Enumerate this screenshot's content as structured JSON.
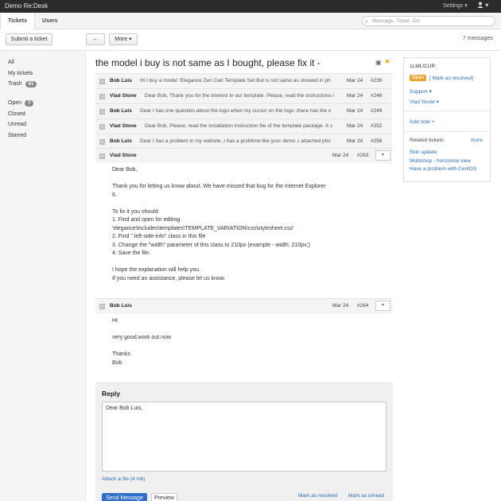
{
  "topbar": {
    "brand": "Demo Re:Desk",
    "settings_label": "Settings",
    "settings_caret": "▾",
    "user_icon": "user-icon",
    "user_caret": "▾"
  },
  "tabs": [
    {
      "label": "Tickets"
    },
    {
      "label": "Users"
    }
  ],
  "search": {
    "placeholder": "Message, Ticket, IDs"
  },
  "toolbar": {
    "submit_label": "Submit a ticket",
    "back_label": "←",
    "more_label": "More ▾",
    "message_count": "7 messages"
  },
  "sidebar": {
    "all": "All",
    "my_tickets": "My tickets",
    "trash": "Trash",
    "trash_count": "61",
    "open": "Open",
    "open_count": "7",
    "closed": "Closed",
    "unread": "Unread",
    "starred": "Starred"
  },
  "ticket": {
    "title": "the model i buy is not same as I bought, please fix it -"
  },
  "messages": [
    {
      "name": "Bob Luis",
      "preview": "Hi I buy a model :Elegance Zen Cart Template Set But is not same as showed in pho",
      "date": "Mar 24",
      "num": "#239"
    },
    {
      "name": "Vlad Stone",
      "preview": "Dear Bob, Thank you for the interest in our template. Please, read the instructions i",
      "date": "Mar 24",
      "num": "#246"
    },
    {
      "name": "Bob Luis",
      "preview": "Dear I has one question about the logo when my cursor on the logo ,there has the w",
      "date": "Mar 24",
      "num": "#249"
    },
    {
      "name": "Vlad Stone",
      "preview": "Dear Bob, Please, read the installation instruction file of the template package. It s",
      "date": "Mar 24",
      "num": "#252"
    },
    {
      "name": "Bob Luis",
      "preview": "Dear I has a problem in my website ,i has a problime like your demo ,i attached photo",
      "date": "Mar 24",
      "num": "#256"
    }
  ],
  "expanded1": {
    "name": "Vlad Stone",
    "date": "Mar 24",
    "num": "#263",
    "lines": [
      "Dear Bob,",
      "",
      "Thank you for letting us know about. We have missed that bug for the Internet Explorer",
      "6.",
      "",
      "To fix it you should:",
      "1. Find and open for editing",
      "'elegance\\includes\\templates\\TEMPLATE_VARIATION\\css\\stylesheet.css'",
      "2. Find \".left-side-info\" class in this file",
      "3. Change the \"width\" parameter of this class to 210px (example - width: 210px;)",
      "4. Save the file.",
      "",
      "I hope the explanation will help you.",
      "If you need an assistance, please let us know."
    ]
  },
  "expanded2": {
    "name": "Bob Luis",
    "date": "Mar 24",
    "num": "#264",
    "lines": [
      "HI",
      "",
      "very good,work out now",
      "",
      "Thanks",
      "Bob"
    ]
  },
  "right_panel": {
    "ticket_id": "1LMLICUR",
    "status": "Open",
    "mark_resolved": "[ Mark as resolved]",
    "department": "Support ▾",
    "assignee": "Vlad Stone ▾",
    "add_note": "Add note +",
    "related_label": "Related tickets:",
    "more": "more",
    "related": [
      "Skin update",
      "Mobishop - horizontal view",
      "Have a problem with CentOS"
    ]
  },
  "reply": {
    "heading": "Reply",
    "text": "Dear Bob Luis,",
    "attach": "Attach a file (4 mb)",
    "send": "Send Message",
    "preview": "Preview",
    "mark_resolved": "Mark as resolved",
    "mark_unread": "Mark as unread"
  }
}
